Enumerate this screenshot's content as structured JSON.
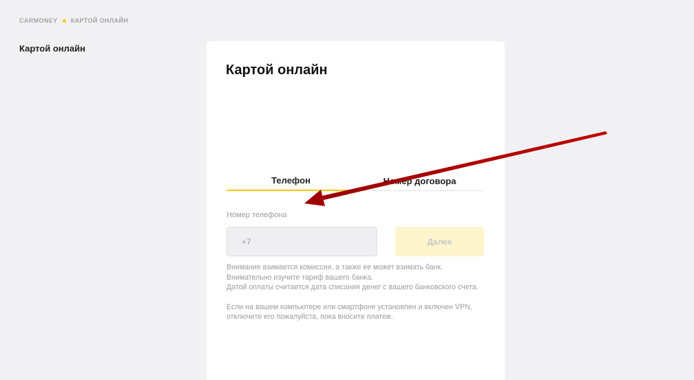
{
  "breadcrumb": {
    "root": "CARMONEY",
    "current": "КАРТОЙ ОНЛАЙН",
    "dot_color": "#f5c800"
  },
  "sidebar": {
    "title": "Картой онлайн"
  },
  "card": {
    "title": "Картой онлайн",
    "tabs": [
      {
        "label": "Телефон",
        "active": true
      },
      {
        "label": "Номер договора",
        "active": false
      }
    ],
    "phone": {
      "label": "Номер телефона",
      "placeholder": "+7"
    },
    "next_button": {
      "label": "Далее",
      "disabled": true
    },
    "notice": {
      "line1": "Внимание взимается комиссия, а также ее может взимать банк. Внимательно изучите тариф вашего банка.",
      "line2": "Датой оплаты считается дата списания денег с вашего банковского счета.",
      "line3": "Если на вашем компьютере или смартфоне установлен и включен VPN, отключите его пожалуйста, пока вносите платеж."
    }
  },
  "annotation": {
    "color": "#b30000",
    "icon": "red-arrow"
  },
  "colors": {
    "accent": "#f5c800",
    "background": "#f1f1f3",
    "card": "#ffffff",
    "button_disabled": "#fff5cc"
  }
}
